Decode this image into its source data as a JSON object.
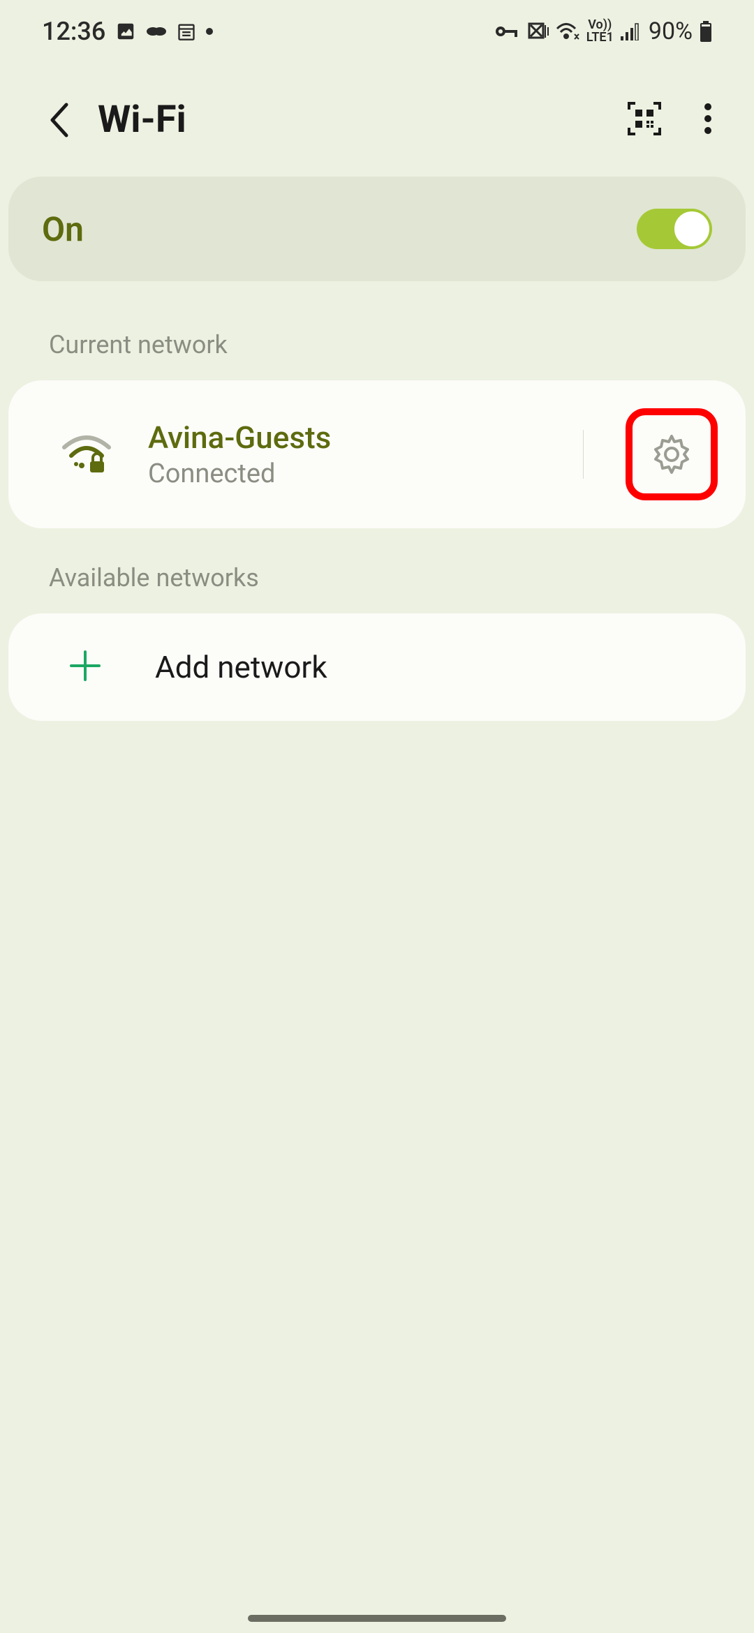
{
  "statusBar": {
    "time": "12:36",
    "battery": "90%",
    "lte": "LTE1",
    "vo": "Vo))"
  },
  "header": {
    "title": "Wi-Fi"
  },
  "toggle": {
    "label": "On",
    "state": true
  },
  "sections": {
    "current": "Current network",
    "available": "Available networks"
  },
  "currentNetwork": {
    "name": "Avina-Guests",
    "status": "Connected"
  },
  "addNetwork": {
    "label": "Add network"
  },
  "colors": {
    "accent": "#5e6b0e",
    "toggleGreen": "#a5c936",
    "highlight": "#ff0000",
    "addGreen": "#1ba864"
  }
}
